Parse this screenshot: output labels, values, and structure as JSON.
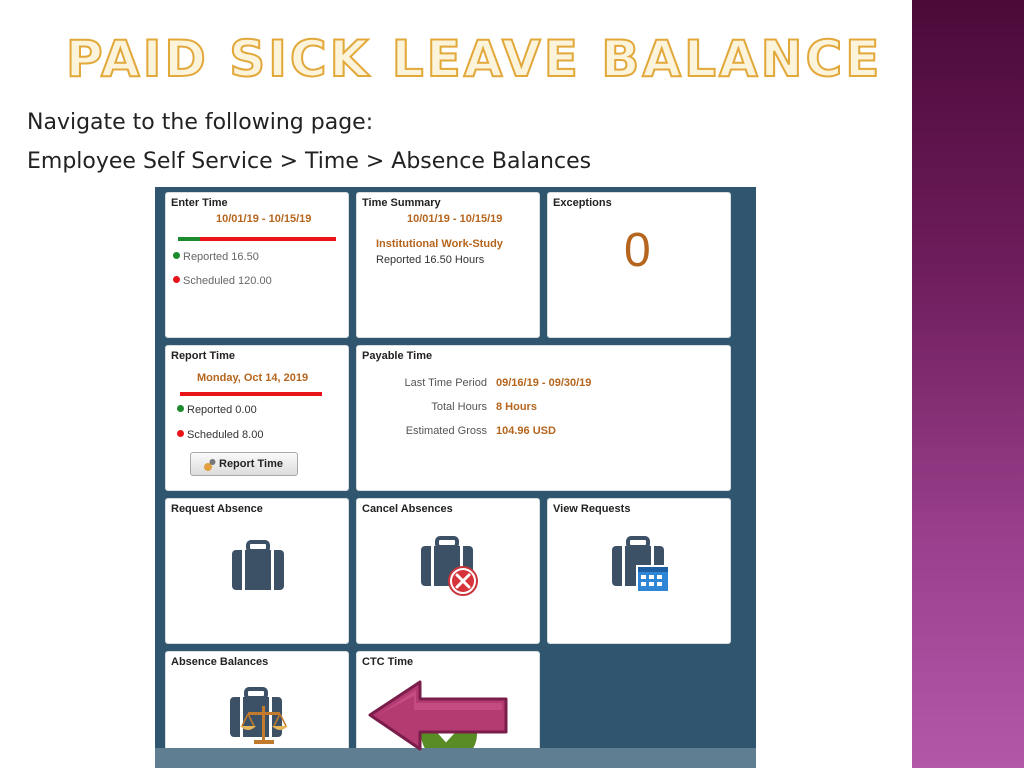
{
  "slide": {
    "title": "Paid Sick Leave Balance",
    "nav_line1": "Navigate to the following page:",
    "nav_line2": "Employee Self Service > Time > Absence Balances"
  },
  "colors": {
    "title_fill": "#fbf3da",
    "title_outline": "#e2a83a",
    "panel_bg": "#30566f",
    "accent_orange": "#b5651d",
    "reported_green": "#1e8a2e",
    "scheduled_red": "#e8141a",
    "icon_slate": "#3d5166",
    "arrow": "#b43b72",
    "side_bar": "#7a2a68"
  },
  "tiles": {
    "enter_time": {
      "title": "Enter Time",
      "period": "10/01/19 - 10/15/19",
      "reported": "Reported 16.50",
      "scheduled": "Scheduled 120.00",
      "progress_reported_fraction": 0.14
    },
    "time_summary": {
      "title": "Time Summary",
      "period": "10/01/19 - 10/15/19",
      "category": "Institutional Work-Study",
      "hours": "Reported 16.50 Hours"
    },
    "exceptions": {
      "title": "Exceptions",
      "count": "0"
    },
    "report_time": {
      "title": "Report Time",
      "date": "Monday, Oct 14, 2019",
      "reported": "Reported 0.00",
      "scheduled": "Scheduled 8.00",
      "button_label": "Report Time"
    },
    "payable_time": {
      "title": "Payable Time",
      "rows": [
        {
          "label": "Last Time Period",
          "value": "09/16/19 - 09/30/19"
        },
        {
          "label": "Total Hours",
          "value": "8 Hours"
        },
        {
          "label": "Estimated Gross",
          "value": "104.96 USD"
        }
      ]
    },
    "request_absence": {
      "title": "Request Absence",
      "icon": "briefcase-icon"
    },
    "cancel_absences": {
      "title": "Cancel Absences",
      "icon": "briefcase-cancel-icon"
    },
    "view_requests": {
      "title": "View Requests",
      "icon": "briefcase-calendar-icon"
    },
    "absence_balances": {
      "title": "Absence Balances",
      "icon": "briefcase-scales-icon"
    },
    "ctc_time": {
      "title": "CTC Time",
      "icon": "checkmark-icon"
    }
  }
}
